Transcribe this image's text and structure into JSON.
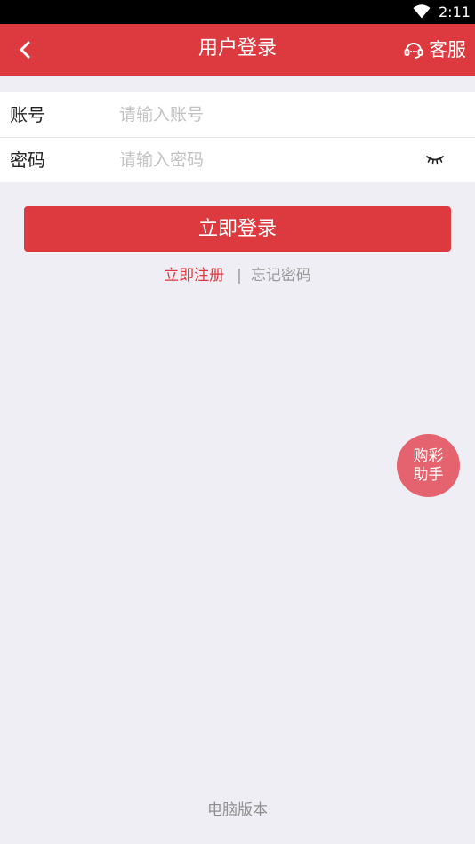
{
  "status_bar": {
    "time": "2:11",
    "wifi_icon": "wifi-icon"
  },
  "app_bar": {
    "back_icon": "chevron-left-icon",
    "title": "用户登录",
    "service_icon": "headset-icon",
    "service_label": "客服",
    "background_color": "#dd3a40"
  },
  "form": {
    "account": {
      "label": "账号",
      "value": "",
      "placeholder": "请输入账号"
    },
    "password": {
      "label": "密码",
      "value": "",
      "placeholder": "请输入密码",
      "toggle_icon": "eye-closed-icon"
    }
  },
  "login_button": {
    "label": "立即登录",
    "color": "#dd3a40"
  },
  "links": {
    "register": "立即注册",
    "divider": "|",
    "forgot_password": "忘记密码"
  },
  "assistant": {
    "line1": "购彩",
    "line2": "助手",
    "color": "#e5636e"
  },
  "footer": {
    "pc_version": "电脑版本"
  }
}
